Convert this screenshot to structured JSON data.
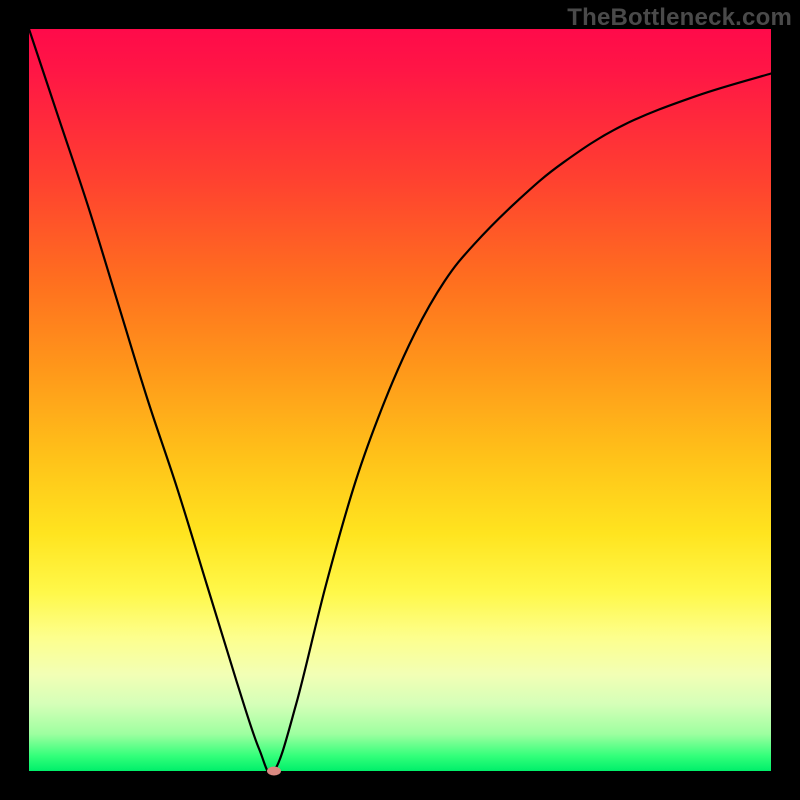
{
  "watermark": "TheBottleneck.com",
  "chart_data": {
    "type": "line",
    "title": "",
    "xlabel": "",
    "ylabel": "",
    "xlim": [
      0,
      100
    ],
    "ylim": [
      0,
      100
    ],
    "grid": false,
    "legend": null,
    "background_gradient": {
      "top_color": "#ff0a4a",
      "bottom_color": "#00ef6a",
      "description": "vertical red-to-green gradient (bottleneck severity, red high, green low)"
    },
    "series": [
      {
        "name": "bottleneck-curve",
        "color": "#000000",
        "x": [
          0,
          4,
          8,
          12,
          16,
          20,
          24,
          28,
          31,
          33,
          36,
          40,
          44,
          48,
          52,
          56,
          60,
          66,
          72,
          80,
          90,
          100
        ],
        "values": [
          100,
          88,
          76,
          63,
          50,
          38,
          25,
          12,
          3,
          0,
          9,
          25,
          39,
          50,
          59,
          66,
          71,
          77,
          82,
          87,
          91,
          94
        ]
      }
    ],
    "min_point": {
      "x": 33,
      "y": 0,
      "marker_color": "#d98880"
    }
  }
}
